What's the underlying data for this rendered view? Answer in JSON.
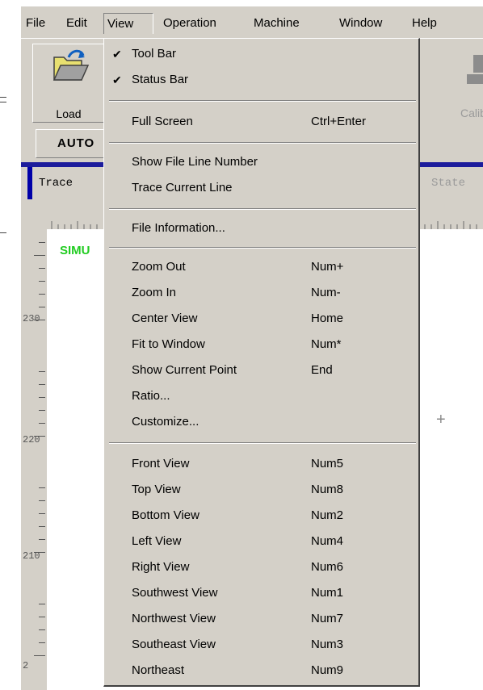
{
  "menubar": {
    "items": [
      "File",
      "Edit",
      "View",
      "Operation",
      "Machine",
      "Window",
      "Help"
    ]
  },
  "toolbar": {
    "load_label": "Load",
    "calib_label": "Calib"
  },
  "mode_tab": "AUTO",
  "panel_tabs": {
    "trace": "Trace",
    "state": "State"
  },
  "canvas": {
    "sim_label": "SIMU",
    "ruler_labels": [
      "230",
      "220",
      "210",
      "2"
    ]
  },
  "view_menu": {
    "items": [
      {
        "label": "Tool Bar",
        "checked": true,
        "shortcut": ""
      },
      {
        "label": "Status Bar",
        "checked": true,
        "shortcut": ""
      },
      {
        "label": "Full Screen",
        "checked": false,
        "shortcut": "Ctrl+Enter"
      },
      {
        "label": "Show File Line Number",
        "checked": false,
        "shortcut": ""
      },
      {
        "label": "Trace Current Line",
        "checked": false,
        "shortcut": ""
      },
      {
        "label": "File Information...",
        "checked": false,
        "shortcut": ""
      },
      {
        "label": "Zoom Out",
        "checked": false,
        "shortcut": "Num+"
      },
      {
        "label": "Zoom In",
        "checked": false,
        "shortcut": "Num-"
      },
      {
        "label": "Center View",
        "checked": false,
        "shortcut": "Home"
      },
      {
        "label": "Fit to Window",
        "checked": false,
        "shortcut": "Num*"
      },
      {
        "label": "Show Current Point",
        "checked": false,
        "shortcut": "End"
      },
      {
        "label": "Ratio...",
        "checked": false,
        "shortcut": ""
      },
      {
        "label": "Customize...",
        "checked": false,
        "shortcut": ""
      },
      {
        "label": "Front View",
        "checked": false,
        "shortcut": "Num5"
      },
      {
        "label": "Top View",
        "checked": false,
        "shortcut": "Num8"
      },
      {
        "label": "Bottom View",
        "checked": false,
        "shortcut": "Num2"
      },
      {
        "label": "Left View",
        "checked": false,
        "shortcut": "Num4"
      },
      {
        "label": "Right View",
        "checked": false,
        "shortcut": "Num6"
      },
      {
        "label": "Southwest View",
        "checked": false,
        "shortcut": "Num1"
      },
      {
        "label": "Northwest View",
        "checked": false,
        "shortcut": "Num7"
      },
      {
        "label": "Southeast View",
        "checked": false,
        "shortcut": "Num3"
      },
      {
        "label": "Northeast",
        "checked": false,
        "shortcut": "Num9"
      }
    ]
  },
  "colors": {
    "chrome": "#d4d0c8",
    "sim_text": "#22cc22",
    "tab_accent": "#0000a8"
  },
  "icons": {
    "load": "folder-open-icon",
    "calib": "calibration-icon",
    "check": "checkmark-icon",
    "cursor": "crosshair-icon"
  }
}
